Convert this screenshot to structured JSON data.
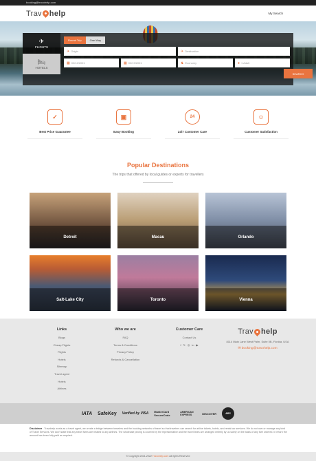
{
  "topbar": {
    "email": "booking@travohelp.com"
  },
  "header": {
    "brand_left": "Trav",
    "brand_right": "help",
    "nav_link": "My Search"
  },
  "search": {
    "tabs": [
      {
        "label": "FLIGHTS",
        "icon": "airplane-icon"
      },
      {
        "label": "HOTELS",
        "icon": "bed-icon"
      }
    ],
    "trip_types": [
      "Round Trip",
      "One Way"
    ],
    "origin_placeholder": "Origin",
    "destination_placeholder": "Destination",
    "depart_date": "02/12/2021",
    "return_date": "02/19/2021",
    "cabin_class": "Economy",
    "passengers": "1 Adult",
    "search_button": "SEARCH"
  },
  "features": [
    {
      "icon": "shield-check-icon",
      "label": "Best Price Guarantee"
    },
    {
      "icon": "booking-screen-icon",
      "label": "Easy Booking"
    },
    {
      "icon": "24-7-icon",
      "label": "24/7 Customer Care"
    },
    {
      "icon": "satisfaction-icon",
      "label": "Customer Satisfaction"
    }
  ],
  "popular": {
    "title": "Popular Destinations",
    "subtitle": "The trips that offered by local guides or experts for travellers",
    "destinations": [
      "Detroit",
      "Macau",
      "Orlando",
      "Salt-Lake City",
      "Toronto",
      "Vienna"
    ]
  },
  "footer": {
    "links": {
      "title": "Links",
      "items": [
        "Blogs",
        "Cheap Flights",
        "Flights",
        "Hotels",
        "Sitemap",
        "Travel agent",
        "Hotels",
        "Airlines"
      ]
    },
    "who": {
      "title": "Who we are",
      "items": [
        "FAQ",
        "Terms & Conditions",
        "Privacy Policy",
        "Refunds & Cancellation"
      ]
    },
    "care": {
      "title": "Customer Care",
      "items": [
        "Contact Us"
      ],
      "social": [
        "f",
        "𝕏",
        "◎",
        "in",
        "▶"
      ]
    },
    "brand": {
      "brand_left": "Trav",
      "brand_right": "help",
      "address": "8114 Main Lane West Palm, Suite 0B, Florida, USA",
      "email": "booking@travohelp.com"
    }
  },
  "partners": [
    "IATA",
    "SafeKey",
    "Verified by VISA",
    "MasterCard SecureCode",
    "AMERICAN EXPRESS",
    "DISCOVER",
    "ARC"
  ],
  "disclaimer": {
    "label": "Disclaimer",
    "text": " - Travohelp works as a travel agent, we create a bridge between travelers and the booking networks of travel so that travelers can search for airline tickets, hotels, and rental car services. We do not own or manage any kind of Travel Services. We don't state that any travel fares are related to any airlines. The wholesale pricing is covered by the representative and the travel fares are arranged entirely by us solely on the basis of any fare ordered. In return the amount has been fully paid as required."
  },
  "copyright": {
    "prefix": "© Copyright 2021-2022",
    "site": "Travohelp.com",
    "suffix": "All rights Reserved"
  }
}
